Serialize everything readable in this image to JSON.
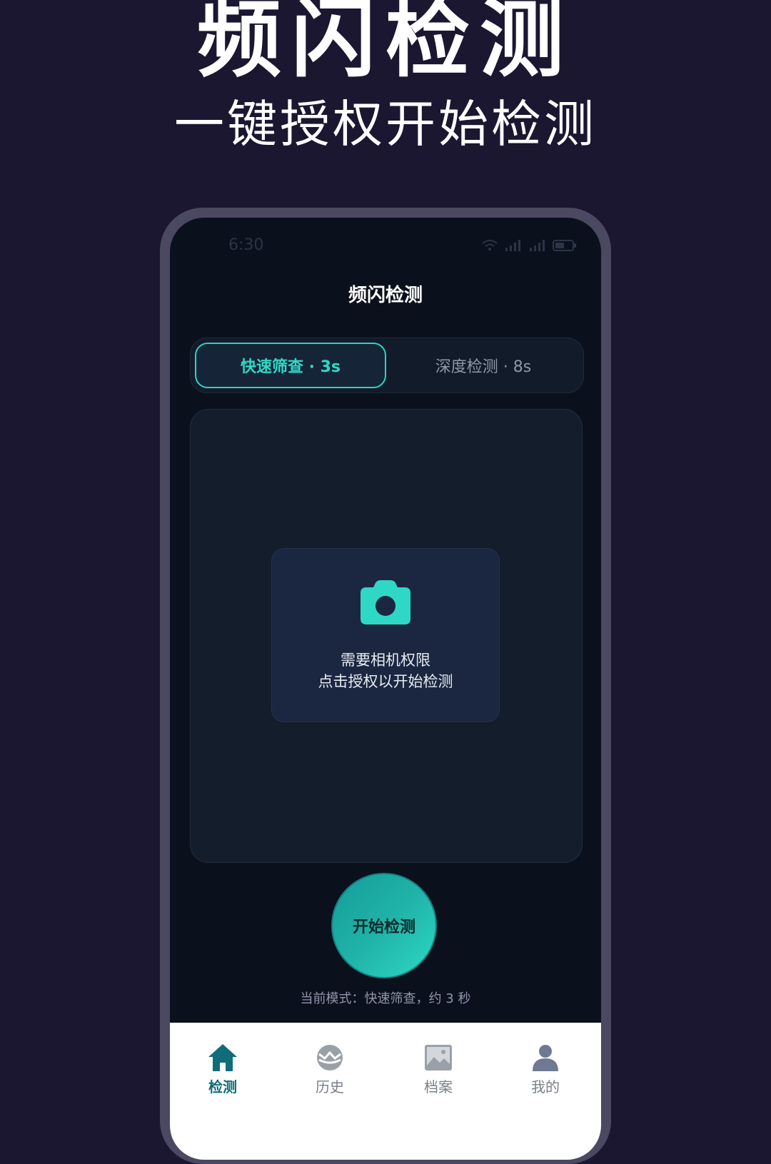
{
  "promo": {
    "headline": "频闪检测",
    "subline": "一键授权开始检测"
  },
  "statusbar": {
    "time": "6:30"
  },
  "app": {
    "title": "频闪检测",
    "modes": [
      {
        "label": "快速筛查 · 3s",
        "selected": true
      },
      {
        "label": "深度检测 · 8s",
        "selected": false
      }
    ],
    "permission": {
      "line1": "需要相机权限",
      "line2": "点击授权以开始检测",
      "icon": "camera-icon"
    },
    "start_button": "开始检测",
    "mode_hint": "当前模式：快速筛查，约 3 秒"
  },
  "tabbar": {
    "items": [
      {
        "label": "检测",
        "icon": "home-icon",
        "active": true
      },
      {
        "label": "历史",
        "icon": "history-icon",
        "active": false
      },
      {
        "label": "档案",
        "icon": "gallery-icon",
        "active": false
      },
      {
        "label": "我的",
        "icon": "person-icon",
        "active": false
      }
    ]
  },
  "colors": {
    "accent": "#2fd8c5",
    "background": "#1b1731",
    "screen": "#0b111c"
  }
}
